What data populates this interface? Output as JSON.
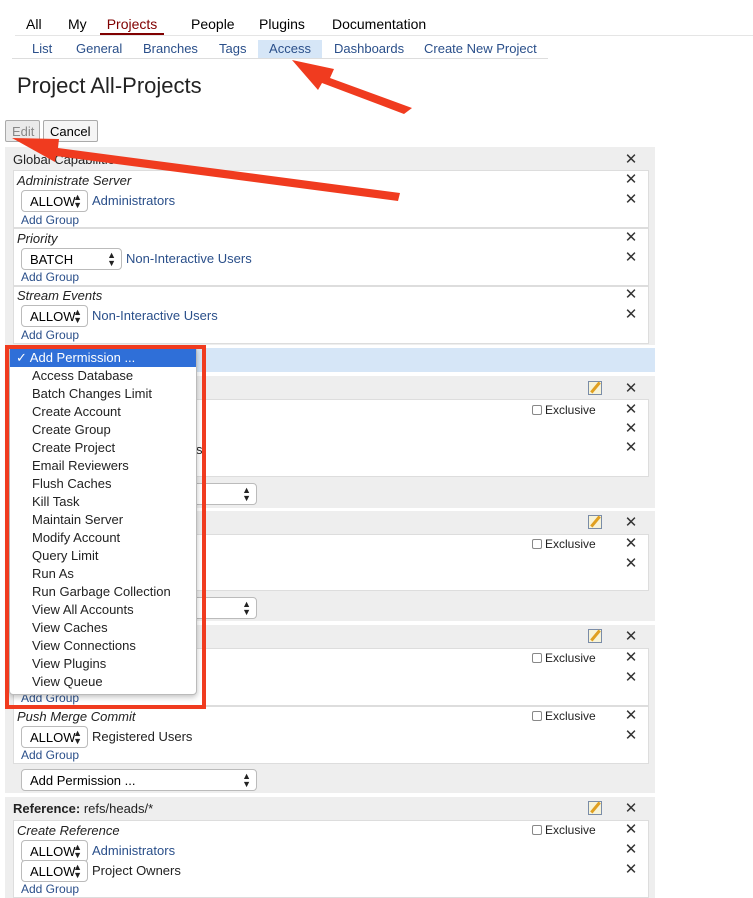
{
  "topnav": [
    "All",
    "My",
    "Projects",
    "People",
    "Plugins",
    "Documentation"
  ],
  "subnav": [
    "List",
    "General",
    "Branches",
    "Tags",
    "Access",
    "Dashboards",
    "Create New Project"
  ],
  "page_title": "Project All-Projects",
  "buttons": {
    "edit": "Edit",
    "cancel": "Cancel"
  },
  "global_capabilities": {
    "title": "Global Capabilities",
    "permissions": [
      {
        "name": "Administrate Server",
        "action": "ALLOW",
        "group": "Administrators",
        "add_group": "Add Group"
      },
      {
        "name": "Priority",
        "action": "BATCH",
        "group": "Non-Interactive Users",
        "add_group": "Add Group"
      },
      {
        "name": "Stream Events",
        "action": "ALLOW",
        "group": "Non-Interactive Users",
        "add_group": "Add Group"
      }
    ]
  },
  "dropdown_options": [
    "Add Permission ...",
    "Access Database",
    "Batch Changes Limit",
    "Create Account",
    "Create Group",
    "Create Project",
    "Email Reviewers",
    "Flush Caches",
    "Kill Task",
    "Maintain Server",
    "Modify Account",
    "Query Limit",
    "Run As",
    "Run Garbage Collection",
    "View All Accounts",
    "View Caches",
    "View Connections",
    "View Plugins",
    "View Queue"
  ],
  "exclusive_label": "Exclusive",
  "partial_visible": {
    "add_group": "Add Group",
    "partial_group_suffix": "s"
  },
  "push_merge": {
    "name": "Push Merge Commit",
    "action": "ALLOW",
    "group": "Registered Users",
    "add_group": "Add Group"
  },
  "add_permission_label": "Add Permission ...",
  "reference": {
    "label": "Reference:",
    "pattern": "refs/heads/*",
    "permission": "Create Reference",
    "rules": [
      {
        "action": "ALLOW",
        "group": "Administrators"
      },
      {
        "action": "ALLOW",
        "group": "Project Owners"
      }
    ],
    "add_group": "Add Group"
  },
  "colors": {
    "accent": "#800000",
    "link": "#2a4f8a",
    "highlight": "#f03b1f",
    "selected": "#2f6fd8"
  }
}
